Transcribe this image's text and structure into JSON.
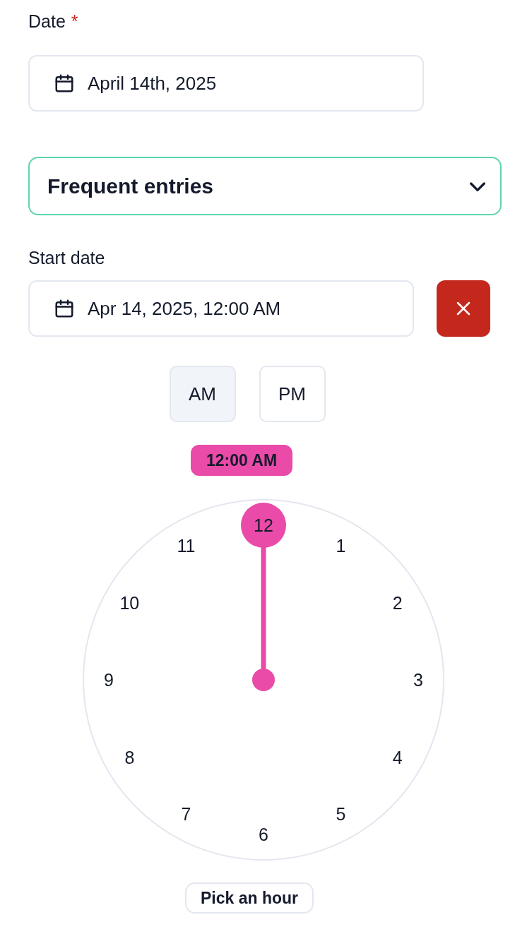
{
  "date_field": {
    "label": "Date",
    "required_mark": "*",
    "value": "April 14th, 2025"
  },
  "frequent_entries": {
    "label": "Frequent entries",
    "expanded": false
  },
  "start_date": {
    "label": "Start date",
    "value": "Apr 14, 2025, 12:00 AM"
  },
  "meridiem": [
    {
      "label": "AM",
      "selected": true
    },
    {
      "label": "PM",
      "selected": false
    }
  ],
  "time_badge": "12:00 AM",
  "clock": {
    "hours": [
      {
        "label": "12",
        "selected": true
      },
      {
        "label": "1",
        "selected": false
      },
      {
        "label": "2",
        "selected": false
      },
      {
        "label": "3",
        "selected": false
      },
      {
        "label": "4",
        "selected": false
      },
      {
        "label": "5",
        "selected": false
      },
      {
        "label": "6",
        "selected": false
      },
      {
        "label": "7",
        "selected": false
      },
      {
        "label": "8",
        "selected": false
      },
      {
        "label": "9",
        "selected": false
      },
      {
        "label": "10",
        "selected": false
      },
      {
        "label": "11",
        "selected": false
      }
    ]
  },
  "mode_button": "Pick an hour"
}
